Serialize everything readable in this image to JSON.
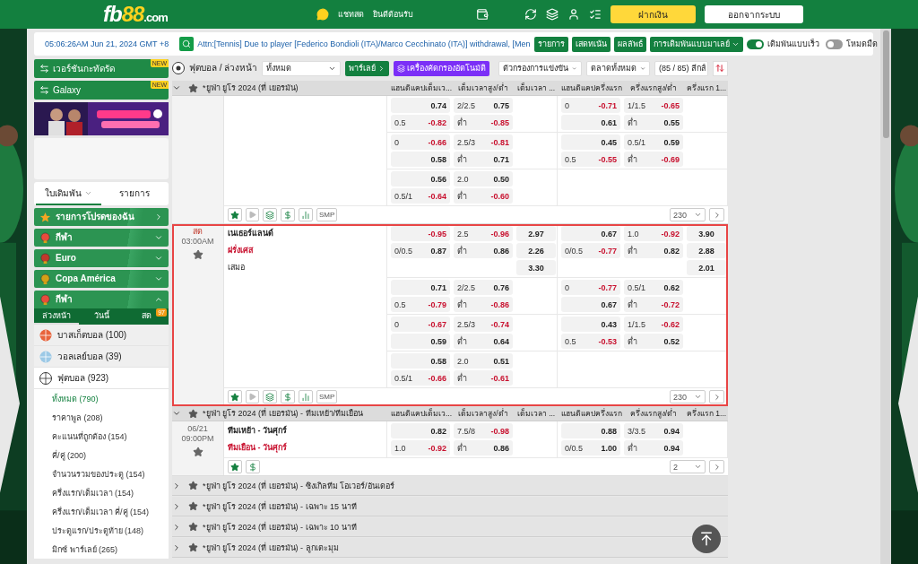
{
  "header": {
    "logo": {
      "prefix": "fb",
      "accent": "88",
      "suffix": ".com"
    },
    "chat": "แชทสด",
    "welcome": "ยินดีต้อนรับ",
    "deposit": "ฝากเงิน",
    "logout": "ออกจากระบบ"
  },
  "topbar": {
    "clock": "05:06:26AM Jun 21, 2024 GMT +8",
    "announcement": "Attn:[Tennis] Due to player [Federico Bondioli (ITA)/Marco Cecchinato (ITA)] withdrawal, [Men",
    "buttons": [
      "รายการ",
      "เสดทเน้น",
      "ผลลัพธ์"
    ],
    "odds_type": "การเดิมพันแบบมาเลย์",
    "toggles": [
      {
        "label": "เดิมพันแบบเร็ว",
        "on": true
      },
      {
        "label": "โหมดมืด",
        "on": false
      }
    ]
  },
  "sidebar": {
    "promos": [
      {
        "label": "เวอร์ชันกะทัดรัด",
        "badge": "NEW"
      },
      {
        "label": "Galaxy",
        "badge": "NEW"
      }
    ],
    "tabs": [
      {
        "label": "ใบเดิมพัน",
        "selected": true
      },
      {
        "label": "รายการ",
        "selected": false
      }
    ],
    "menus": [
      {
        "kind": "favorites",
        "label": "รายการโปรดของฉัน",
        "expanded": false
      },
      {
        "kind": "sports",
        "label": "กีฬา",
        "expanded": false
      },
      {
        "kind": "euro",
        "label": "Euro",
        "expanded": false
      },
      {
        "kind": "copa",
        "label": "Copa América",
        "expanded": false
      },
      {
        "kind": "sports",
        "label": "กีฬา",
        "expanded": true
      }
    ],
    "period_tabs": [
      {
        "label": "ล่วงหน้า",
        "selected": true
      },
      {
        "label": "วันนี้",
        "selected": false
      },
      {
        "label": "สด",
        "selected": false,
        "badge": "97"
      }
    ],
    "sports": [
      {
        "kind": "basketball",
        "label": "บาสเก็ตบอล (100)",
        "expanded": false
      },
      {
        "kind": "volleyball",
        "label": "วอลเลย์บอล (39)",
        "expanded": false
      },
      {
        "kind": "soccer",
        "label": "ฟุตบอล (923)",
        "expanded": true,
        "children": [
          {
            "label": "ทั้งหมด (790)",
            "selected": true
          },
          {
            "label": "ราคาพูล (208)",
            "selected": false
          },
          {
            "label": "คะแนนที่ถูกต้อง (154)",
            "selected": false
          },
          {
            "label": "คี่/คู่ (200)",
            "selected": false
          },
          {
            "label": "จำนวนรวมของประตู (154)",
            "selected": false
          },
          {
            "label": "ครึ่งแรก/เต็มเวลา (154)",
            "selected": false
          },
          {
            "label": "ครึ่งแรก/เต็มเวลา คี่/คู่ (154)",
            "selected": false
          },
          {
            "label": "ประตูแรก/ประตูท้าย (148)",
            "selected": false
          },
          {
            "label": "มิกซ์ พาร์เลย์ (265)",
            "selected": false
          }
        ]
      }
    ]
  },
  "filters": {
    "title": "ฟุตบอล / ล่วงหน้า",
    "scope": "ทั้งหมด",
    "parlay": "พาร์เลย์",
    "auto_filter": "เครื่องคัดกรองอัตโนมัติ",
    "competition": "ตัวกรองการแข่งขัน",
    "market": "ตลาดทั้งหมด",
    "leagues": "(85 / 85) ลีกส์"
  },
  "leagues": [
    {
      "title": "*ยูฟ่า ยูโร 2024 (ที่ เยอรมัน)",
      "expanded": true,
      "columns": [
        "แฮนดิแคปเต็มเว...",
        "เต็มเวลาสูง/ต่ำ",
        "เต็มเวลา ...",
        "แฮนดิแคปครึ่งแรก",
        "ครึ่งแรกสูง/ต่ำ",
        "ครึ่งแรก 1..."
      ],
      "matches": [
        {
          "highlighted": false,
          "tools": [
            {
              "kind": "star"
            },
            {
              "kind": "play"
            },
            {
              "kind": "list"
            },
            {
              "kind": "dollar"
            },
            {
              "kind": "stats"
            },
            {
              "kind": "smp",
              "label": "SMP"
            }
          ],
          "more": "230",
          "lines": [
            {
              "ft": {
                "hdp": [
                  {
                    "odds": "0.74"
                  },
                  {
                    "line": "0.5",
                    "odds": "-0.82",
                    "negative": true
                  }
                ],
                "ou": [
                  {
                    "line": "2/2.5",
                    "odds": "0.75"
                  },
                  {
                    "line": "ต่ำ",
                    "odds": "-0.85",
                    "negative": true
                  }
                ]
              },
              "ht": {
                "hdp": [
                  {
                    "line": "0",
                    "odds": "-0.71",
                    "negative": true
                  },
                  {
                    "odds": "0.61"
                  }
                ],
                "ou": [
                  {
                    "line": "1/1.5",
                    "odds": "-0.65",
                    "negative": true
                  },
                  {
                    "line": "ต่ำ",
                    "odds": "0.55"
                  }
                ]
              }
            },
            {
              "ft": {
                "hdp": [
                  {
                    "line": "0",
                    "odds": "-0.66",
                    "negative": true
                  },
                  {
                    "odds": "0.58"
                  }
                ],
                "ou": [
                  {
                    "line": "2.5/3",
                    "odds": "-0.81",
                    "negative": true
                  },
                  {
                    "line": "ต่ำ",
                    "odds": "0.71"
                  }
                ]
              },
              "ht": {
                "hdp": [
                  {
                    "odds": "0.45"
                  },
                  {
                    "line": "0.5",
                    "odds": "-0.55",
                    "negative": true
                  }
                ],
                "ou": [
                  {
                    "line": "0.5/1",
                    "odds": "0.59"
                  },
                  {
                    "line": "ต่ำ",
                    "odds": "-0.69",
                    "negative": true
                  }
                ]
              }
            },
            {
              "ft": {
                "hdp": [
                  {
                    "odds": "0.56"
                  },
                  {
                    "line": "0.5/1",
                    "odds": "-0.64",
                    "negative": true
                  }
                ],
                "ou": [
                  {
                    "line": "2.0",
                    "odds": "0.50"
                  },
                  {
                    "line": "ต่ำ",
                    "odds": "-0.60",
                    "negative": true
                  }
                ]
              }
            }
          ]
        },
        {
          "live": "สด",
          "time": "03:00AM",
          "highlighted": true,
          "teams": [
            {
              "name": "เนเธอร์แลนด์",
              "kind": "team",
              "favorite": false
            },
            {
              "name": "ฝรั่งเศส",
              "kind": "team",
              "favorite": true
            },
            {
              "name": "เสมอ",
              "kind": "draw",
              "favorite": false
            }
          ],
          "tools": [
            {
              "kind": "star"
            },
            {
              "kind": "play"
            },
            {
              "kind": "list"
            },
            {
              "kind": "dollar"
            },
            {
              "kind": "stats"
            },
            {
              "kind": "smp",
              "label": "SMP"
            }
          ],
          "more": "230",
          "lines": [
            {
              "ft": {
                "hdp": [
                  {
                    "odds": "-0.95",
                    "negative": true
                  },
                  {
                    "line": "0/0.5",
                    "odds": "0.87"
                  }
                ],
                "ou": [
                  {
                    "line": "2.5",
                    "odds": "-0.96",
                    "negative": true
                  },
                  {
                    "line": "ต่ำ",
                    "odds": "0.86"
                  }
                ],
                "x12": [
                  {
                    "odds": "2.97"
                  },
                  {
                    "odds": "2.26"
                  },
                  {
                    "odds": "3.30"
                  }
                ]
              },
              "ht": {
                "hdp": [
                  {
                    "odds": "0.67"
                  },
                  {
                    "line": "0/0.5",
                    "odds": "-0.77",
                    "negative": true
                  }
                ],
                "ou": [
                  {
                    "line": "1.0",
                    "odds": "-0.92",
                    "negative": true
                  },
                  {
                    "line": "ต่ำ",
                    "odds": "0.82"
                  }
                ],
                "x12": [
                  {
                    "odds": "3.90"
                  },
                  {
                    "odds": "2.88"
                  },
                  {
                    "odds": "2.01"
                  }
                ]
              }
            },
            {
              "ft": {
                "hdp": [
                  {
                    "odds": "0.71"
                  },
                  {
                    "line": "0.5",
                    "odds": "-0.79",
                    "negative": true
                  }
                ],
                "ou": [
                  {
                    "line": "2/2.5",
                    "odds": "0.76"
                  },
                  {
                    "line": "ต่ำ",
                    "odds": "-0.86",
                    "negative": true
                  }
                ]
              },
              "ht": {
                "hdp": [
                  {
                    "line": "0",
                    "odds": "-0.77",
                    "negative": true
                  },
                  {
                    "odds": "0.67"
                  }
                ],
                "ou": [
                  {
                    "line": "0.5/1",
                    "odds": "0.62"
                  },
                  {
                    "line": "ต่ำ",
                    "odds": "-0.72",
                    "negative": true
                  }
                ]
              }
            },
            {
              "ft": {
                "hdp": [
                  {
                    "line": "0",
                    "odds": "-0.67",
                    "negative": true
                  },
                  {
                    "odds": "0.59"
                  }
                ],
                "ou": [
                  {
                    "line": "2.5/3",
                    "odds": "-0.74",
                    "negative": true
                  },
                  {
                    "line": "ต่ำ",
                    "odds": "0.64"
                  }
                ]
              },
              "ht": {
                "hdp": [
                  {
                    "odds": "0.43"
                  },
                  {
                    "line": "0.5",
                    "odds": "-0.53",
                    "negative": true
                  }
                ],
                "ou": [
                  {
                    "line": "1/1.5",
                    "odds": "-0.62",
                    "negative": true
                  },
                  {
                    "line": "ต่ำ",
                    "odds": "0.52"
                  }
                ]
              }
            },
            {
              "ft": {
                "hdp": [
                  {
                    "odds": "0.58"
                  },
                  {
                    "line": "0.5/1",
                    "odds": "-0.66",
                    "negative": true
                  }
                ],
                "ou": [
                  {
                    "line": "2.0",
                    "odds": "0.51"
                  },
                  {
                    "line": "ต่ำ",
                    "odds": "-0.61",
                    "negative": true
                  }
                ]
              }
            }
          ]
        }
      ]
    },
    {
      "title": "*ยูฟ่า ยูโร 2024 (ที่ เยอรมัน) - ทีมเหย้า/ทีมเยือน",
      "expanded": true,
      "columns": [
        "แฮนดิแคปเต็มเว...",
        "เต็มเวลาสูง/ต่ำ",
        "เต็มเวลา ...",
        "แฮนดิแคปครึ่งแรก",
        "ครึ่งแรกสูง/ต่ำ",
        "ครึ่งแรก 1..."
      ],
      "matches": [
        {
          "date": "06/21",
          "time": "09:00PM",
          "highlighted": false,
          "teams": [
            {
              "name": "ทีมเหย้า - วันศุกร์",
              "kind": "team",
              "favorite": false
            },
            {
              "name": "ทีมเยือน - วันศุกร์",
              "kind": "team",
              "favorite": true
            }
          ],
          "tools": [
            {
              "kind": "star"
            },
            {
              "kind": "dollar"
            }
          ],
          "more": "2",
          "lines": [
            {
              "ft": {
                "hdp": [
                  {
                    "odds": "0.82"
                  },
                  {
                    "line": "1.0",
                    "odds": "-0.92",
                    "negative": true
                  }
                ],
                "ou": [
                  {
                    "line": "7.5/8",
                    "odds": "-0.98",
                    "negative": true
                  },
                  {
                    "line": "ต่ำ",
                    "odds": "0.86"
                  }
                ]
              },
              "ht": {
                "hdp": [
                  {
                    "odds": "0.88"
                  },
                  {
                    "line": "0/0.5",
                    "odds": "1.00"
                  }
                ],
                "ou": [
                  {
                    "line": "3/3.5",
                    "odds": "0.94"
                  },
                  {
                    "line": "ต่ำ",
                    "odds": "0.94"
                  }
                ]
              }
            }
          ]
        }
      ]
    },
    {
      "title": "*ยูฟ่า ยูโร 2024 (ที่ เยอรมัน) - ซิงเกิลทีม โอเวอร์/อันเดอร์",
      "expanded": false
    },
    {
      "title": "*ยูฟ่า ยูโร 2024 (ที่ เยอรมัน) - เฉพาะ 15 นาที",
      "expanded": false
    },
    {
      "title": "*ยูฟ่า ยูโร 2024 (ที่ เยอรมัน) - เฉพาะ 10 นาที",
      "expanded": false
    },
    {
      "title": "*ยูฟ่า ยูโร 2024 (ที่ เยอรมัน) - ลูกเตะมุม",
      "expanded": false
    }
  ]
}
